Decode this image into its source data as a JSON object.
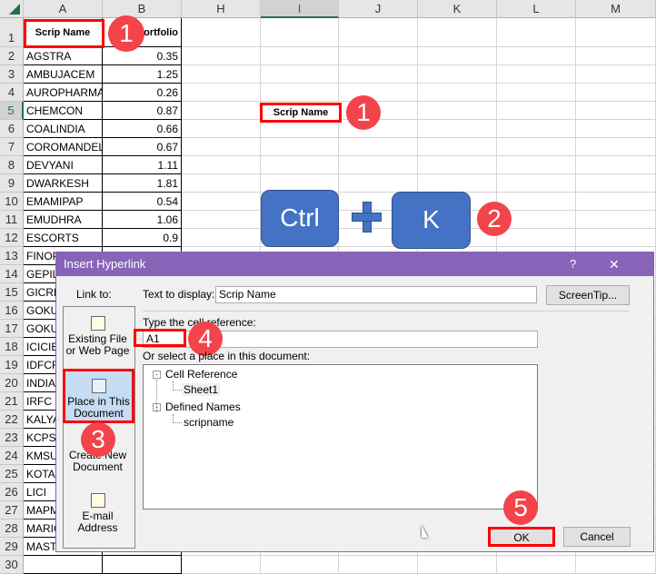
{
  "sheet": {
    "columns": [
      "A",
      "B",
      "H",
      "I",
      "J",
      "K",
      "L",
      "M"
    ],
    "selected_column": "I",
    "selected_row": "5",
    "header_row": {
      "col_a": "Scrip Name",
      "col_b": "Portfolio"
    },
    "rows": [
      [
        "AGSTRA",
        "0.35"
      ],
      [
        "AMBUJACEM",
        "1.25"
      ],
      [
        "AUROPHARMA",
        "0.26"
      ],
      [
        "CHEMCON",
        "0.87"
      ],
      [
        "COALINDIA",
        "0.66"
      ],
      [
        "COROMANDEL",
        "0.67"
      ],
      [
        "DEVYANI",
        "1.11"
      ],
      [
        "DWARKESH",
        "1.81"
      ],
      [
        "EMAMIPAP",
        "0.54"
      ],
      [
        "EMUDHRA",
        "1.06"
      ],
      [
        "ESCORTS",
        "0.9"
      ],
      [
        "FINOP",
        ""
      ],
      [
        "GEPIL",
        ""
      ],
      [
        "GICRE",
        ""
      ],
      [
        "GOKU",
        ""
      ],
      [
        "GOKU",
        ""
      ],
      [
        "ICICIB",
        ""
      ],
      [
        "IDFCF",
        ""
      ],
      [
        "INDIA",
        ""
      ],
      [
        "IRFC",
        ""
      ],
      [
        "KALYA",
        ""
      ],
      [
        "KCPSU",
        ""
      ],
      [
        "KMSU",
        ""
      ],
      [
        "KOTAR",
        ""
      ],
      [
        "LICI",
        ""
      ],
      [
        "MAPM",
        ""
      ],
      [
        "MARIC",
        ""
      ],
      [
        "MASTI",
        ""
      ]
    ],
    "i5_value": "Scrip Name"
  },
  "annotations": {
    "badge1": "1",
    "badge2": "2",
    "badge3": "3",
    "badge4": "4",
    "badge5": "5",
    "key_ctrl": "Ctrl",
    "key_plus": "+",
    "key_k": "K",
    "accent": "#f2444a",
    "key_color": "#4472c4"
  },
  "dialog": {
    "title": "Insert Hyperlink",
    "help": "?",
    "close": "✕",
    "link_to_label": "Link to:",
    "link_items": [
      {
        "label1": "Existing File",
        "label2": "or Web Page",
        "icon": "file-globe-icon"
      },
      {
        "label1": "Place in This",
        "label2": "Document",
        "icon": "place-in-document-icon",
        "selected": true
      },
      {
        "label1": "Create New",
        "label2": "Document",
        "icon": "new-document-icon"
      },
      {
        "label1": "E-mail",
        "label2": "Address",
        "icon": "email-icon"
      }
    ],
    "text_to_display_label": "Text to display:",
    "text_to_display_value": "Scrip Name",
    "screentip_button": "ScreenTip...",
    "cell_ref_label": "Type the cell reference:",
    "cell_ref_value": "A1",
    "select_place_label": "Or select a place in this document:",
    "tree": {
      "node1": "Cell Reference",
      "node1_child": "Sheet1",
      "node2": "Defined Names",
      "node2_child": "scripname"
    },
    "ok_button": "OK",
    "cancel_button": "Cancel",
    "title_color": "#8764b8"
  }
}
